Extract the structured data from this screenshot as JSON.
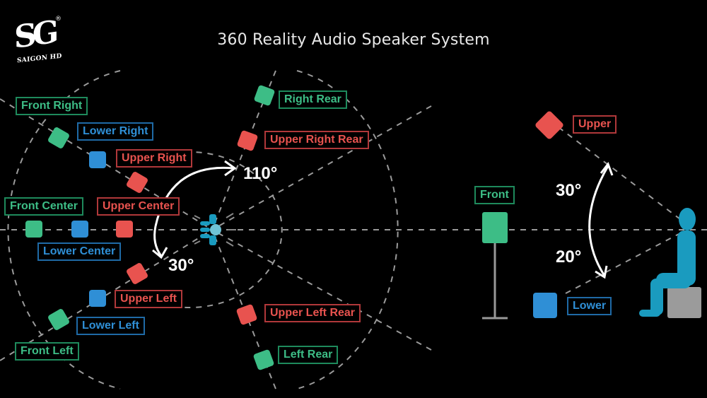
{
  "title": "360 Reality Audio Speaker System",
  "logo": {
    "mark": "SG",
    "registered": "®",
    "text": "SAIGON HD"
  },
  "colors": {
    "front_green": "#3dbd86",
    "lower_blue": "#2f8fd6",
    "upper_red": "#e8534f",
    "listener_teal": "#1a9bbf",
    "guide_gray": "#9a9a9a",
    "seat_gray": "#9b9b9b"
  },
  "top_view": {
    "listener_icon": "listener-head-icon",
    "angles": {
      "front_angle": "30°",
      "rear_angle": "110°"
    },
    "speakers": [
      {
        "id": "front-right",
        "label": "Front Right",
        "layer": "front"
      },
      {
        "id": "lower-right",
        "label": "Lower Right",
        "layer": "lower"
      },
      {
        "id": "upper-right",
        "label": "Upper Right",
        "layer": "upper"
      },
      {
        "id": "front-center",
        "label": "Front Center",
        "layer": "front"
      },
      {
        "id": "lower-center",
        "label": "Lower Center",
        "layer": "lower"
      },
      {
        "id": "upper-center",
        "label": "Upper Center",
        "layer": "upper"
      },
      {
        "id": "upper-left",
        "label": "Upper Left",
        "layer": "upper"
      },
      {
        "id": "lower-left",
        "label": "Lower Left",
        "layer": "lower"
      },
      {
        "id": "front-left",
        "label": "Front Left",
        "layer": "front"
      },
      {
        "id": "right-rear",
        "label": "Right Rear",
        "layer": "front"
      },
      {
        "id": "upper-right-rear",
        "label": "Upper Right Rear",
        "layer": "upper"
      },
      {
        "id": "upper-left-rear",
        "label": "Upper Left Rear",
        "layer": "upper"
      },
      {
        "id": "left-rear",
        "label": "Left Rear",
        "layer": "front"
      }
    ]
  },
  "side_view": {
    "angles": {
      "upper_angle": "30°",
      "lower_angle": "20°"
    },
    "speakers": [
      {
        "id": "side-upper",
        "label": "Upper",
        "layer": "upper"
      },
      {
        "id": "side-front",
        "label": "Front",
        "layer": "front"
      },
      {
        "id": "side-lower",
        "label": "Lower",
        "layer": "lower"
      }
    ]
  }
}
